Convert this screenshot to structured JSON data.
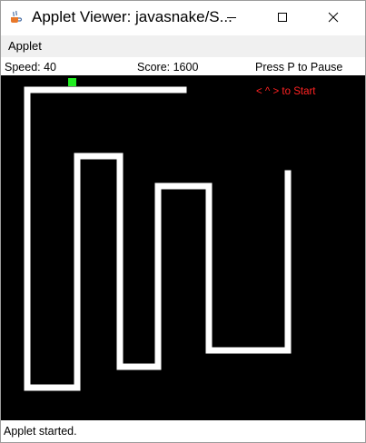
{
  "window": {
    "title": "Applet Viewer: javasnake/S...",
    "app_icon": "java-cup-icon",
    "controls": {
      "minimize_icon": "minimize-icon",
      "maximize_icon": "maximize-icon",
      "close_icon": "close-icon"
    }
  },
  "menubar": {
    "applet_label": "Applet"
  },
  "status": {
    "speed": "Speed: 40",
    "score": "Score: 1600",
    "pause_hint": "Press P to Pause"
  },
  "game": {
    "start_hint": "< ^ > to Start",
    "colors": {
      "background": "#000000",
      "snake": "#ffffff",
      "food": "#22ee22",
      "hint": "#ff2222"
    }
  },
  "footer": {
    "status_text": "Applet started."
  }
}
